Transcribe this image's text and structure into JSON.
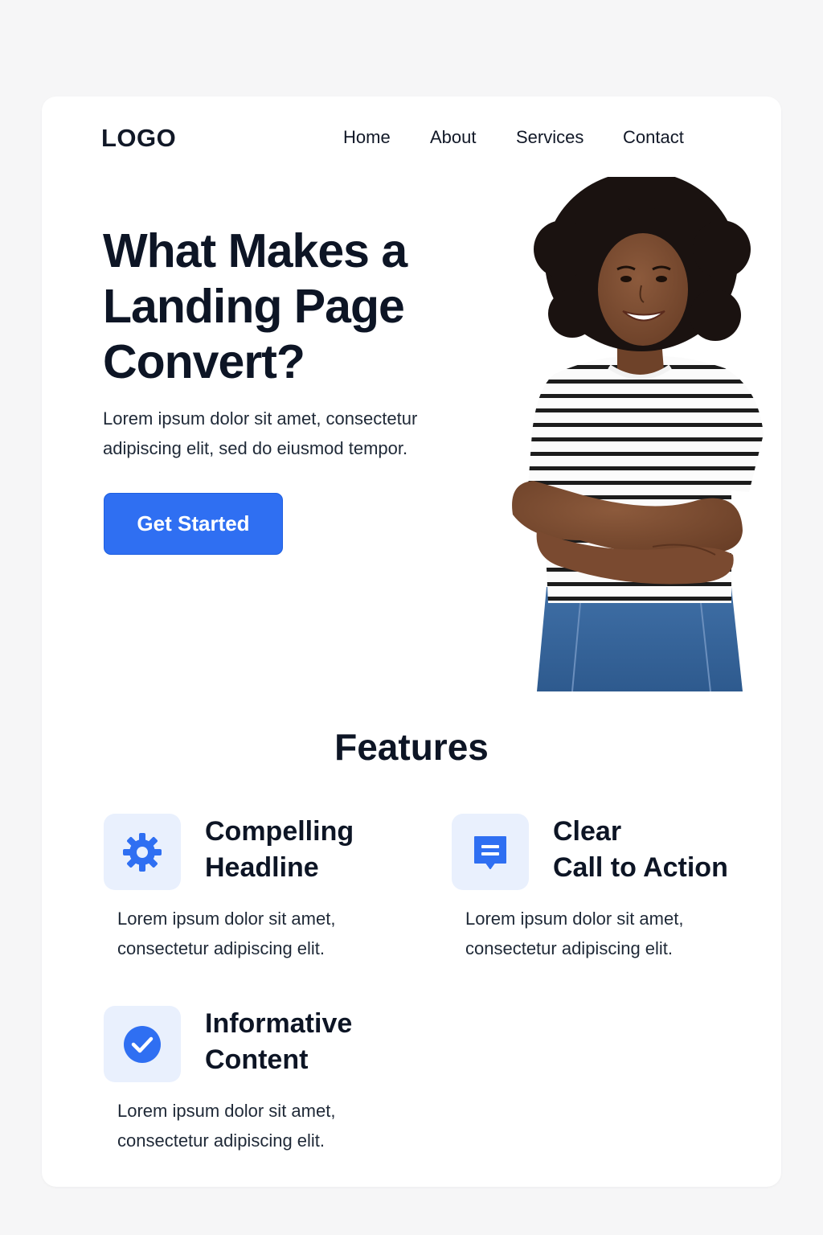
{
  "header": {
    "logo": "LOGO",
    "nav": [
      "Home",
      "About",
      "Services",
      "Contact"
    ]
  },
  "hero": {
    "title": "What Makes a Landing Page Convert?",
    "subtitle": "Lorem ipsum dolor sit amet, consectetur adipiscing elit, sed do eiusmod tempor.",
    "cta_label": "Get Started"
  },
  "features": {
    "heading": "Features",
    "items": [
      {
        "icon": "gear-icon",
        "title": "Compelling\nHeadline",
        "text": "Lorem ipsum dolor sit amet, consectetur adipiscing elit."
      },
      {
        "icon": "message-icon",
        "title": "Clear\nCall to Action",
        "text": "Lorem ipsum dolor sit amet, consectetur adipiscing elit."
      },
      {
        "icon": "checkmark-circle-icon",
        "title": "Informative\nContent",
        "text": "Lorem ipsum dolor sit amet, consectetur adipiscing elit."
      }
    ]
  },
  "colors": {
    "accent": "#2f6ff2",
    "icon_bg": "#e9f0fd",
    "text": "#0d1525",
    "page_bg": "#f6f6f7"
  }
}
